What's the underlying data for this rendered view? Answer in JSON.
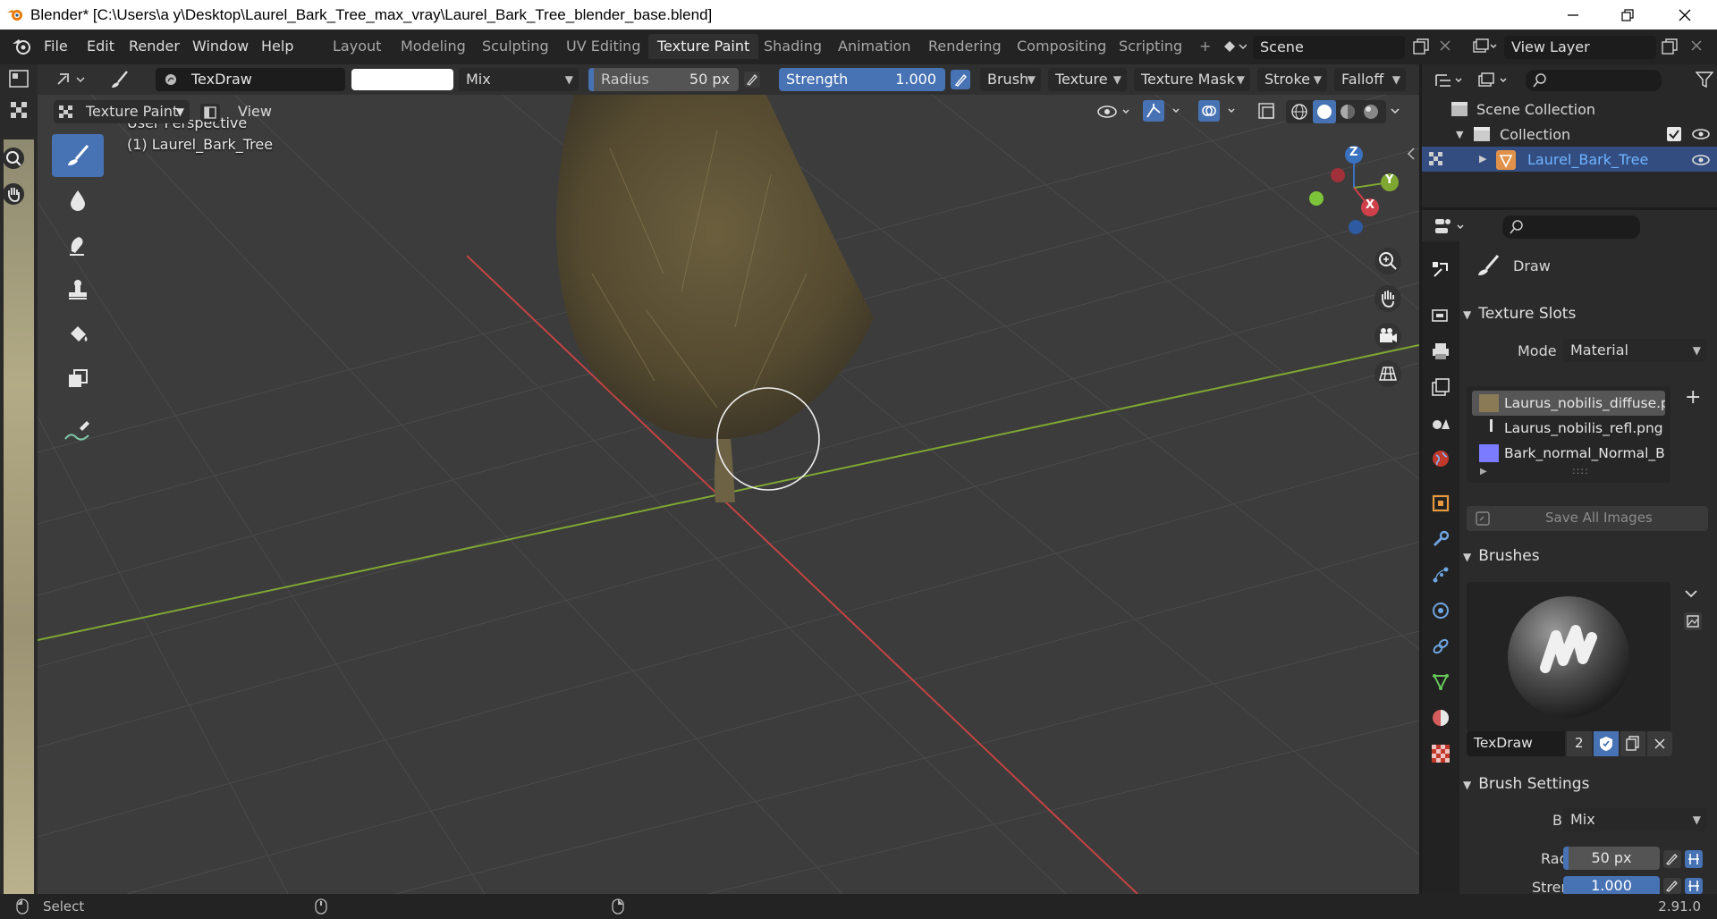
{
  "window": {
    "title": "Blender* [C:\\Users\\a y\\Desktop\\Laurel_Bark_Tree_max_vray\\Laurel_Bark_Tree_blender_base.blend]",
    "minimize_icon": "minimize-icon",
    "maximize_icon": "restore-icon",
    "close_icon": "close-icon"
  },
  "menu": {
    "items": [
      "File",
      "Edit",
      "Render",
      "Window",
      "Help"
    ]
  },
  "workspaces": {
    "tabs": [
      "Layout",
      "Modeling",
      "Sculpting",
      "UV Editing",
      "Texture Paint",
      "Shading",
      "Animation",
      "Rendering",
      "Compositing",
      "Scripting"
    ],
    "active": "Texture Paint",
    "add_label": "+"
  },
  "scene": {
    "name": "Scene"
  },
  "view_layer": {
    "name": "View Layer"
  },
  "tool_header": {
    "brush_name": "TexDraw",
    "blend": "Mix",
    "radius_label": "Radius",
    "radius_value": "50 px",
    "strength_label": "Strength",
    "strength_value": "1.000",
    "brush_menu": "Brush",
    "texture_menu": "Texture",
    "texture_mask_menu": "Texture Mask",
    "stroke_menu": "Stroke",
    "falloff_menu": "Falloff",
    "color_swatch": "#ffffff"
  },
  "viewport": {
    "mode": "Texture Paint",
    "view_menu": "View",
    "perspective": "User Perspective",
    "object": "(1) Laurel_Bark_Tree",
    "gizmo": {
      "x": "X",
      "y": "Y",
      "z": "Z"
    }
  },
  "outliner": {
    "scene_collection": "Scene Collection",
    "collection": "Collection",
    "object": "Laurel_Bark_Tree"
  },
  "properties": {
    "active_tool": "Draw",
    "texture_slots": {
      "title": "Texture Slots",
      "mode_label": "Mode",
      "mode_value": "Material",
      "slots": [
        {
          "name": "Laurus_nobilis_diffuse.p...",
          "swatch": "#8a7a55"
        },
        {
          "name": "Laurus_nobilis_refl.png",
          "swatch": "#e0e0e0"
        },
        {
          "name": "Bark_normal_Normal_B...",
          "swatch": "#7b7bff"
        }
      ],
      "save_all": "Save All Images"
    },
    "brushes": {
      "title": "Brushes",
      "brush_name": "TexDraw",
      "users": "2"
    },
    "brush_settings": {
      "title": "Brush Settings",
      "blend_label": "Blend",
      "blend_value": "Mix",
      "radius_label": "Radius",
      "radius_value": "50 px",
      "strength_label": "Strength",
      "strength_value": "1.000"
    }
  },
  "statusbar": {
    "select": "Select",
    "version": "2.91.0"
  },
  "colors": {
    "accent": "#4772b3",
    "x_axis": "#c44343",
    "y_axis": "#7fa832",
    "selected_object": "#4a8fd8"
  }
}
